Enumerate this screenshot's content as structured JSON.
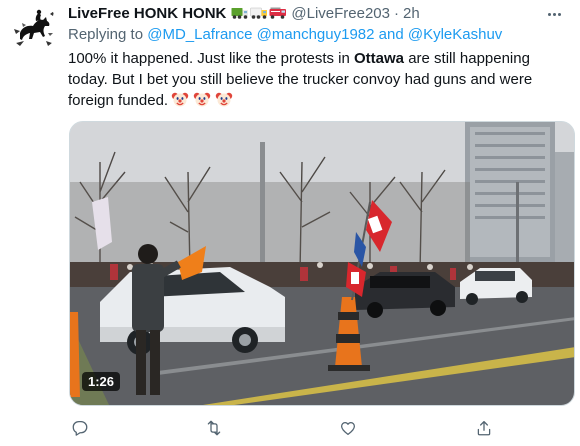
{
  "tweet": {
    "author": {
      "display_name": "LiveFree HONK HONK",
      "handle": "@LiveFree203",
      "time": "2h",
      "separator": "·",
      "name_emojis": [
        "truck-emoji",
        "truck-emoji",
        "fire-engine-emoji"
      ],
      "avatar_icon": "horse-rider-avatar"
    },
    "replying_to": {
      "prefix": "Replying to",
      "mention_1": "@MD_Lafrance",
      "mention_2": "@manchguy1982",
      "conjunction": "and",
      "mention_3": "@KyleKashuv"
    },
    "text": {
      "part1": "100% it happened. Just like the protests in ",
      "bold": "Ottawa",
      "part2": " are still happening today. But I bet you still believe the trucker convoy had guns and were foreign funded.",
      "emojis": [
        "clown-face-emoji",
        "clown-face-emoji",
        "clown-face-emoji"
      ]
    },
    "media": {
      "type": "video",
      "duration": "1:26"
    },
    "actions": {
      "icons": [
        "reply-icon",
        "retweet-icon",
        "like-icon",
        "share-icon"
      ]
    },
    "colors": {
      "accent": "#1d9bf0",
      "secondary_text": "#536471",
      "primary_text": "#0f1419"
    }
  }
}
